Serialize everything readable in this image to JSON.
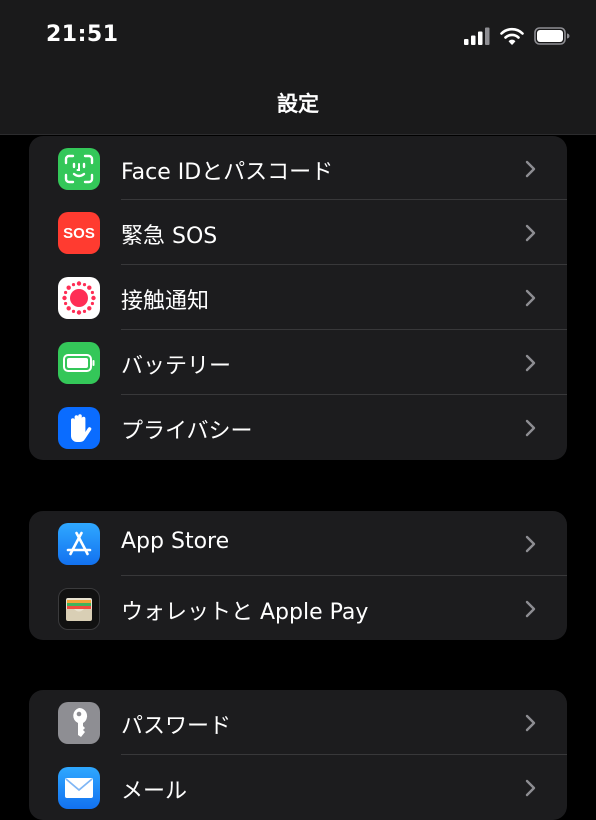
{
  "status_bar": {
    "time": "21:51"
  },
  "nav": {
    "title": "設定"
  },
  "groups": [
    {
      "items": [
        {
          "label": "Face IDとパスコード",
          "icon": "face-id-icon",
          "color": "#34c759"
        },
        {
          "label": "緊急 SOS",
          "icon": "sos-icon",
          "icon_text": "SOS",
          "color": "#ff3b30"
        },
        {
          "label": "接触通知",
          "icon": "exposure-notification-icon",
          "color": "#ffffff"
        },
        {
          "label": "バッテリー",
          "icon": "battery-icon",
          "color": "#34c759"
        },
        {
          "label": "プライバシー",
          "icon": "hand-icon",
          "color": "#0a6cff"
        }
      ]
    },
    {
      "items": [
        {
          "label": "App Store",
          "icon": "app-store-icon",
          "color": "#1a8cff"
        },
        {
          "label": "ウォレットと Apple Pay",
          "icon": "wallet-icon",
          "color": "#111111"
        }
      ]
    },
    {
      "items": [
        {
          "label": "パスワード",
          "icon": "key-icon",
          "color": "#8e8e93"
        },
        {
          "label": "メール",
          "icon": "mail-icon",
          "color": "#1a8cff"
        }
      ]
    }
  ]
}
